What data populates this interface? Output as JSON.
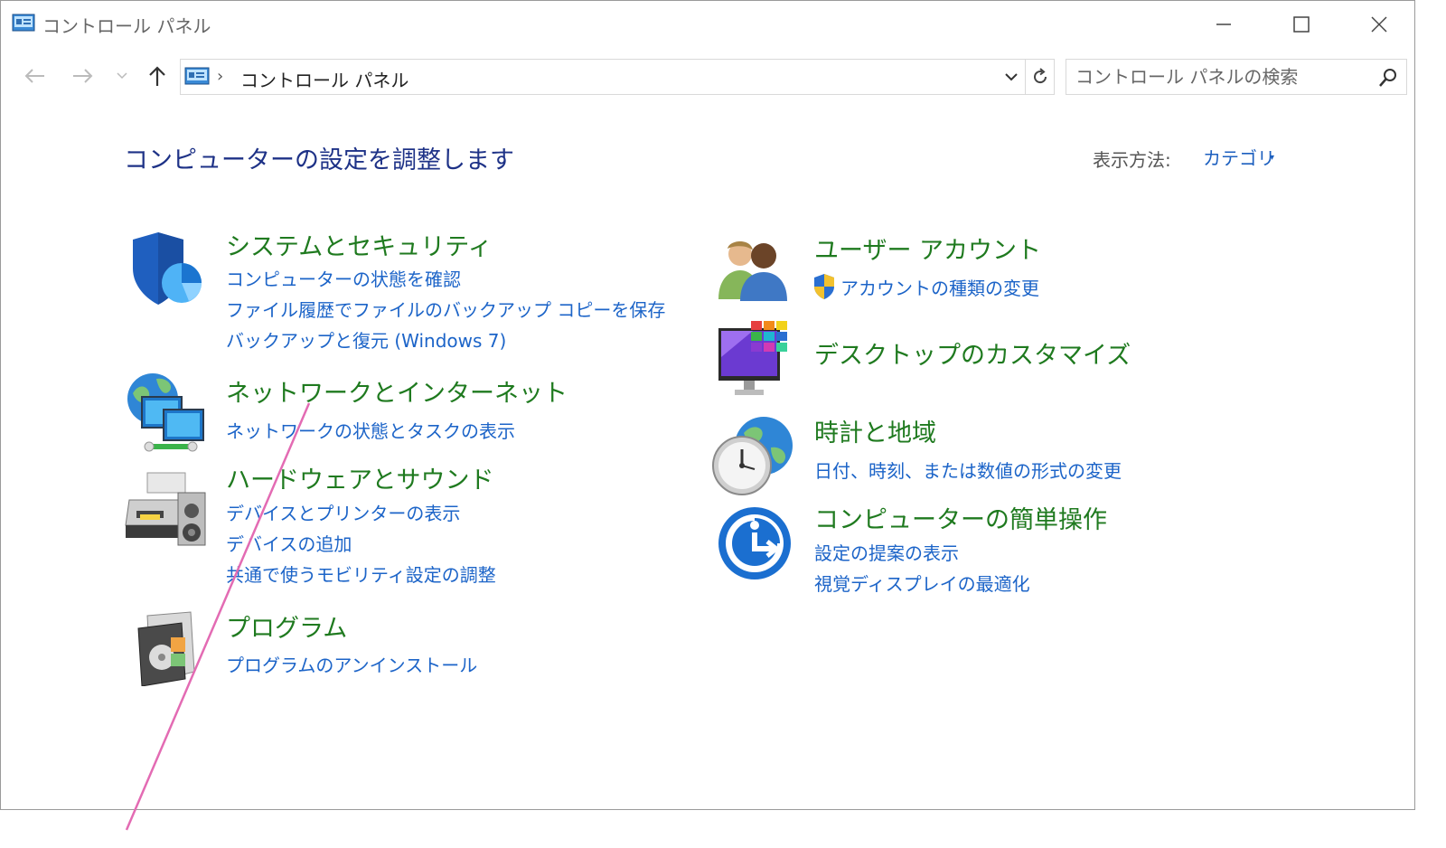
{
  "window": {
    "title": "コントロール パネル",
    "controls": {
      "minimize_icon": "minimize-icon",
      "maximize_icon": "maximize-icon",
      "close_icon": "close-icon"
    }
  },
  "navbar": {
    "breadcrumb_separator": "›",
    "address": "コントロール パネル",
    "search_placeholder": "コントロール パネルの検索"
  },
  "header": {
    "title": "コンピューターの設定を調整します",
    "view_label": "表示方法:",
    "view_value": "カテゴリ",
    "view_caret": "▾"
  },
  "categories": {
    "system": {
      "title": "システムとセキュリティ",
      "links": [
        "コンピューターの状態を確認",
        "ファイル履歴でファイルのバックアップ コピーを保存",
        "バックアップと復元 (Windows 7)"
      ]
    },
    "network": {
      "title": "ネットワークとインターネット",
      "links": [
        "ネットワークの状態とタスクの表示"
      ]
    },
    "hardware": {
      "title": "ハードウェアとサウンド",
      "links": [
        "デバイスとプリンターの表示",
        "デバイスの追加",
        "共通で使うモビリティ設定の調整"
      ]
    },
    "programs": {
      "title": "プログラム",
      "links": [
        "プログラムのアンインストール"
      ]
    },
    "users": {
      "title": "ユーザー アカウント",
      "links": [
        "アカウントの種類の変更"
      ]
    },
    "desktop": {
      "title": "デスクトップのカスタマイズ",
      "links": []
    },
    "clock": {
      "title": "時計と地域",
      "links": [
        "日付、時刻、または数値の形式の変更"
      ]
    },
    "access": {
      "title": "コンピューターの簡単操作",
      "links": [
        "設定の提案の表示",
        "視覚ディスプレイの最適化"
      ]
    }
  },
  "colors": {
    "category_title": "#1f7a1f",
    "link": "#1c64c8",
    "page_title": "#1e3287",
    "annotation_line": "#e36bb3"
  }
}
